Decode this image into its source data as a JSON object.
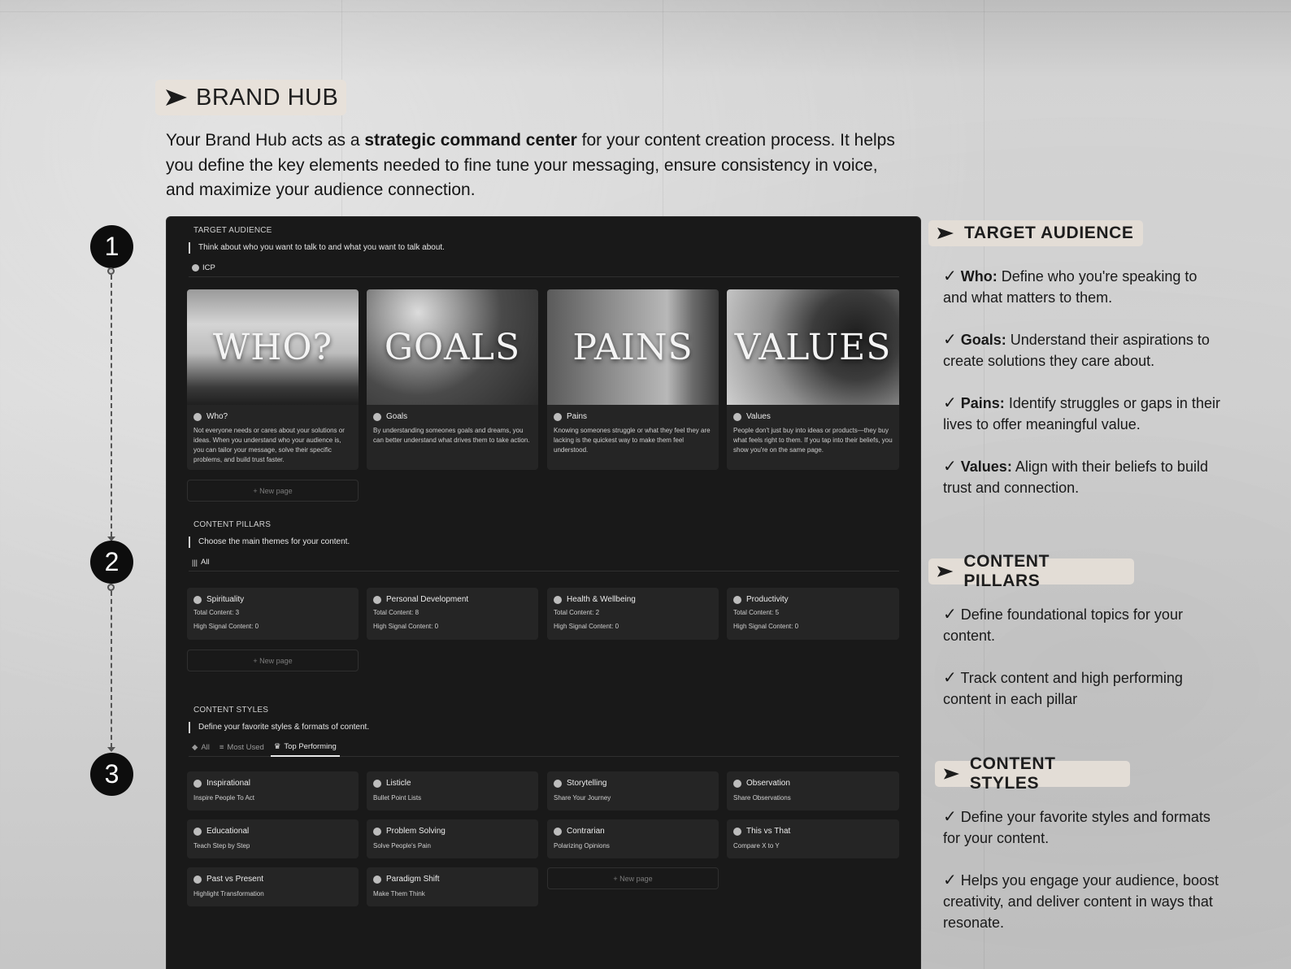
{
  "header": {
    "title": "BRAND HUB",
    "intro_before": "Your Brand Hub  acts as a ",
    "intro_bold": "strategic command center",
    "intro_after": " for your content creation process. It helps you define the key elements needed to fine tune your messaging, ensure consistency in voice, and maximize your audience connection."
  },
  "steps": [
    "1",
    "2",
    "3"
  ],
  "target_audience": {
    "label": "TARGET AUDIENCE",
    "quote": "Think about who you want to talk to and what you want to talk about.",
    "view": "ICP",
    "cards": [
      {
        "image_text": "WHO?",
        "title": "Who?",
        "desc": "Not everyone needs or cares about your solutions or ideas. When you understand who your audience is, you can tailor your message, solve their specific problems, and build trust faster."
      },
      {
        "image_text": "GOALS",
        "title": "Goals",
        "desc": "By understanding someones goals and dreams, you can better understand what drives them to take action."
      },
      {
        "image_text": "PAINS",
        "title": "Pains",
        "desc": "Knowing someones struggle or what they feel they are lacking is the quickest way to make them feel understood."
      },
      {
        "image_text": "VALUES",
        "title": "Values",
        "desc": "People don't just buy into ideas or products—they buy what feels right to them. If you tap into their beliefs, you show you're on the same page."
      }
    ],
    "new_page": "+ New page"
  },
  "content_pillars": {
    "label": "CONTENT PILLARS",
    "quote": "Choose the main themes for your content.",
    "view": "All",
    "cards": [
      {
        "title": "Spirituality",
        "total": "Total Content: 3",
        "high": "High Signal Content: 0"
      },
      {
        "title": "Personal Development",
        "total": "Total Content: 8",
        "high": "High Signal Content: 0"
      },
      {
        "title": "Health & Wellbeing",
        "total": "Total Content: 2",
        "high": "High Signal Content: 0"
      },
      {
        "title": "Productivity",
        "total": "Total Content: 5",
        "high": "High Signal Content: 0"
      }
    ],
    "new_page": "+ New page"
  },
  "content_styles": {
    "label": "CONTENT STYLES",
    "quote": "Define your favorite styles & formats of content.",
    "tabs": [
      "All",
      "Most Used",
      "Top Performing"
    ],
    "cards": [
      {
        "title": "Inspirational",
        "sub": "Inspire People To Act"
      },
      {
        "title": "Listicle",
        "sub": "Bullet Point Lists"
      },
      {
        "title": "Storytelling",
        "sub": "Share Your Journey"
      },
      {
        "title": "Observation",
        "sub": "Share Observations"
      },
      {
        "title": "Educational",
        "sub": "Teach Step by Step"
      },
      {
        "title": "Problem Solving",
        "sub": "Solve People's Pain"
      },
      {
        "title": "Contrarian",
        "sub": "Polarizing Opinions"
      },
      {
        "title": "This vs That",
        "sub": "Compare X to Y"
      },
      {
        "title": "Past vs Present",
        "sub": "Highlight Transformation"
      },
      {
        "title": "Paradigm Shift",
        "sub": "Make Them Think"
      }
    ],
    "new_page": "+ New page"
  },
  "right": {
    "ta_title": "TARGET AUDIENCE",
    "ta_items": [
      {
        "bold": "Who:",
        "text": " Define who you're speaking to and what matters to them."
      },
      {
        "bold": "Goals:",
        "text": " Understand their aspirations to create solutions they care about."
      },
      {
        "bold": "Pains:",
        "text": " Identify struggles or gaps in their lives to offer meaningful value."
      },
      {
        "bold": "Values:",
        "text": " Align with their beliefs to build trust and connection."
      }
    ],
    "cp_title": "CONTENT PILLARS",
    "cp_items": [
      "Define foundational topics for your content.",
      "Track content  and high performing content in each pillar"
    ],
    "cs_title": "CONTENT STYLES",
    "cs_items": [
      "Define your favorite styles and formats for your content.",
      "Helps you engage your audience, boost creativity, and deliver content in ways that resonate."
    ],
    "check": "✓"
  }
}
